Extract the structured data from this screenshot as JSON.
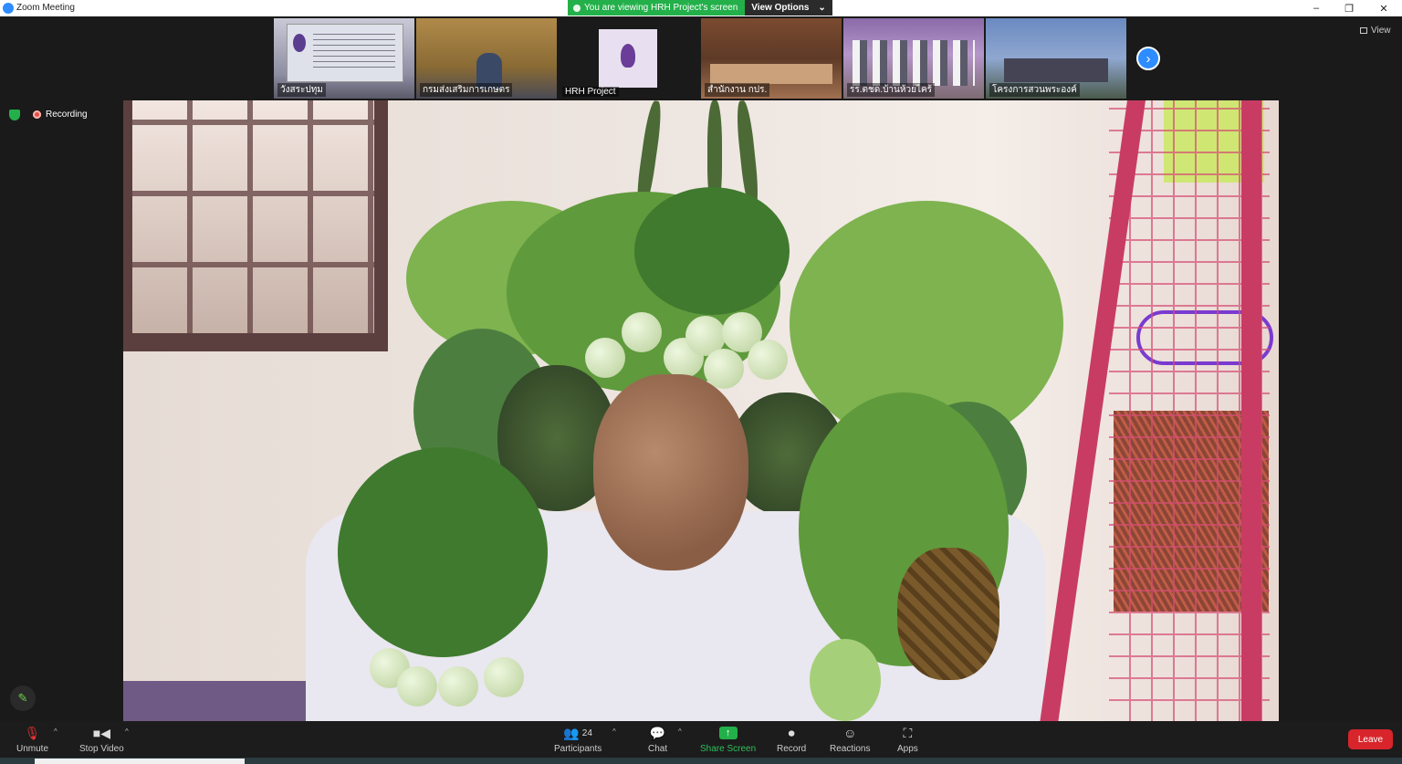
{
  "window": {
    "title": "Zoom Meeting",
    "minimize": "–",
    "restore": "❐",
    "close": "✕"
  },
  "share_banner": {
    "text": "You are viewing HRH Project's screen",
    "view_options": "View Options",
    "view_options_caret": "⌄"
  },
  "thumbnails": [
    {
      "name": "วังสระปทุม"
    },
    {
      "name": "กรมส่งเสริมการเกษตร"
    },
    {
      "name": "HRH Project"
    },
    {
      "name": "สำนักงาน กปร."
    },
    {
      "name": "รร.ตชด.บ้านห้วยไคร้"
    },
    {
      "name": "โครงการสวนพระองค์"
    }
  ],
  "view_button": {
    "label": "View"
  },
  "next_icon": "›",
  "recording": {
    "label": "Recording"
  },
  "toolbar": {
    "unmute": "Unmute",
    "stop_video": "Stop Video",
    "participants": "Participants",
    "participants_count": "24",
    "chat": "Chat",
    "share_screen": "Share Screen",
    "record": "Record",
    "reactions": "Reactions",
    "apps": "Apps",
    "leave": "Leave"
  },
  "icons": {
    "mic": "mic-muted-icon",
    "video": "video-camera-icon",
    "participants": "people-icon",
    "chat": "chat-bubble-icon",
    "share": "share-screen-icon",
    "record": "record-icon",
    "reactions": "emoji-icon",
    "apps": "apps-icon",
    "pen": "pencil-icon"
  },
  "colors": {
    "accent": "#2d8cff",
    "share_green": "#23b04a",
    "leave_red": "#d8252b"
  }
}
